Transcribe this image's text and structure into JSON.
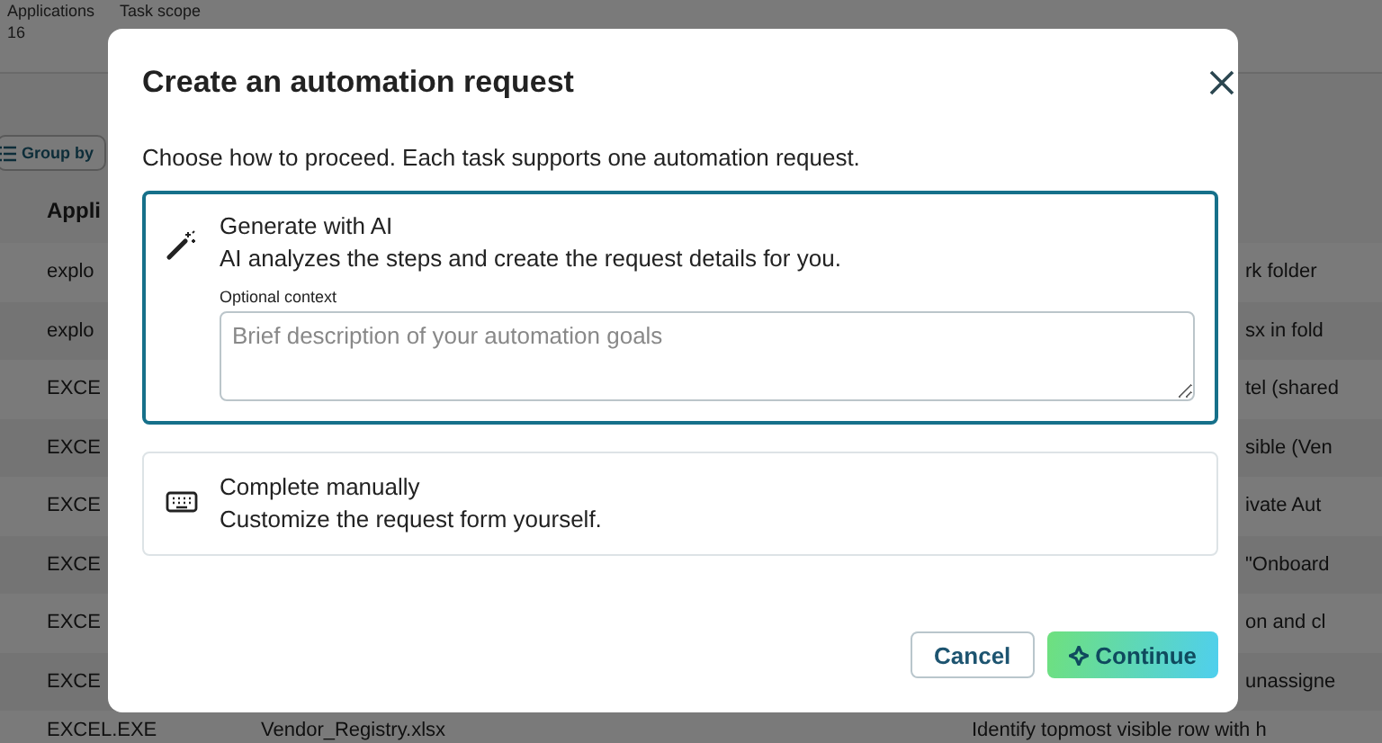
{
  "background_page": {
    "summary": [
      {
        "label": "Applications",
        "value": "16"
      },
      {
        "label": "Task scope"
      }
    ],
    "group_by_button": "Group by",
    "table": {
      "column_1_header": "Appli",
      "rows": [
        {
          "column_1": "explo",
          "column_3": "rk folder"
        },
        {
          "column_1": "explo",
          "column_3": "sx in fold"
        },
        {
          "column_1": "EXCE",
          "column_3": "tel (shared"
        },
        {
          "column_1": "EXCE",
          "column_3": "sible (Ven"
        },
        {
          "column_1": "EXCE",
          "column_3": "ivate Aut"
        },
        {
          "column_1": "EXCE",
          "column_3": "\"Onboard"
        },
        {
          "column_1": "EXCE",
          "column_3": "on and cl"
        },
        {
          "column_1": "EXCE",
          "column_3": "unassigne"
        },
        {
          "column_1": "EXCEL.EXE",
          "column_2": "Vendor_Registry.xlsx",
          "column_3": "Identify topmost visible row with h"
        }
      ]
    }
  },
  "dialog": {
    "title": "Create an automation request",
    "intro": "Choose how to proceed. Each task supports one automation request.",
    "options": [
      {
        "kind": "ai",
        "title": "Generate with AI",
        "description": "AI analyzes the steps and create the request details for you.",
        "selected": true,
        "context_label": "Optional context",
        "context_placeholder": "Brief description of your automation goals"
      },
      {
        "kind": "manual",
        "title": "Complete manually",
        "description": "Customize the request form yourself.",
        "selected": false
      }
    ],
    "buttons": {
      "cancel": "Cancel",
      "continue": "Continue"
    }
  }
}
